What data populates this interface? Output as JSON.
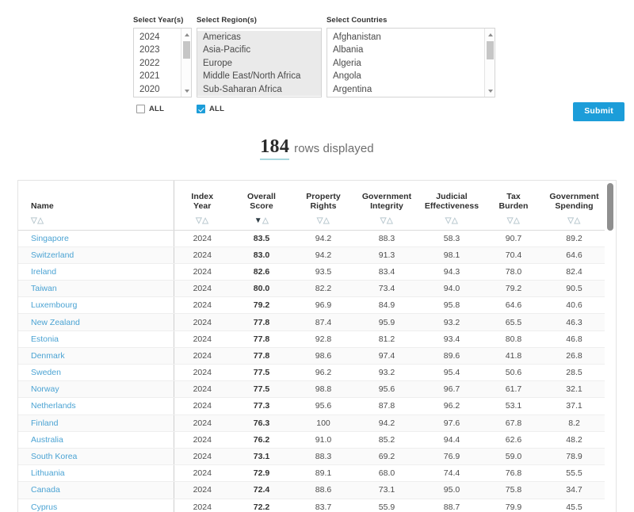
{
  "filters": {
    "year": {
      "label": "Select Year(s)",
      "options": [
        "2024",
        "2023",
        "2022",
        "2021",
        "2020"
      ],
      "selected": [],
      "all_label": "ALL",
      "all_checked": false
    },
    "region": {
      "label": "Select Region(s)",
      "options": [
        "Americas",
        "Asia-Pacific",
        "Europe",
        "Middle East/North Africa",
        "Sub-Saharan Africa"
      ],
      "selected": [
        "Americas",
        "Asia-Pacific",
        "Europe",
        "Middle East/North Africa",
        "Sub-Saharan Africa"
      ],
      "all_label": "ALL",
      "all_checked": true
    },
    "country": {
      "label": "Select Countries",
      "options": [
        "Afghanistan",
        "Albania",
        "Algeria",
        "Angola",
        "Argentina"
      ],
      "selected": []
    },
    "submit_label": "Submit"
  },
  "status": {
    "count": "184",
    "count_text": "rows displayed"
  },
  "table": {
    "columns": [
      {
        "label_line1": "Name",
        "label_line2": "",
        "sort": "none"
      },
      {
        "label_line1": "Index",
        "label_line2": "Year",
        "sort": "none"
      },
      {
        "label_line1": "Overall",
        "label_line2": "Score",
        "sort": "desc"
      },
      {
        "label_line1": "Property",
        "label_line2": "Rights",
        "sort": "none"
      },
      {
        "label_line1": "Government",
        "label_line2": "Integrity",
        "sort": "none"
      },
      {
        "label_line1": "Judicial",
        "label_line2": "Effectiveness",
        "sort": "none"
      },
      {
        "label_line1": "Tax",
        "label_line2": "Burden",
        "sort": "none"
      },
      {
        "label_line1": "Government",
        "label_line2": "Spending",
        "sort": "none"
      }
    ],
    "rows": [
      {
        "name": "Singapore",
        "year": "2024",
        "overall": "83.5",
        "property": "94.2",
        "integrity": "88.3",
        "judicial": "58.3",
        "tax": "90.7",
        "spending": "89.2"
      },
      {
        "name": "Switzerland",
        "year": "2024",
        "overall": "83.0",
        "property": "94.2",
        "integrity": "91.3",
        "judicial": "98.1",
        "tax": "70.4",
        "spending": "64.6"
      },
      {
        "name": "Ireland",
        "year": "2024",
        "overall": "82.6",
        "property": "93.5",
        "integrity": "83.4",
        "judicial": "94.3",
        "tax": "78.0",
        "spending": "82.4"
      },
      {
        "name": "Taiwan",
        "year": "2024",
        "overall": "80.0",
        "property": "82.2",
        "integrity": "73.4",
        "judicial": "94.0",
        "tax": "79.2",
        "spending": "90.5"
      },
      {
        "name": "Luxembourg",
        "year": "2024",
        "overall": "79.2",
        "property": "96.9",
        "integrity": "84.9",
        "judicial": "95.8",
        "tax": "64.6",
        "spending": "40.6"
      },
      {
        "name": "New Zealand",
        "year": "2024",
        "overall": "77.8",
        "property": "87.4",
        "integrity": "95.9",
        "judicial": "93.2",
        "tax": "65.5",
        "spending": "46.3"
      },
      {
        "name": "Estonia",
        "year": "2024",
        "overall": "77.8",
        "property": "92.8",
        "integrity": "81.2",
        "judicial": "93.4",
        "tax": "80.8",
        "spending": "46.8"
      },
      {
        "name": "Denmark",
        "year": "2024",
        "overall": "77.8",
        "property": "98.6",
        "integrity": "97.4",
        "judicial": "89.6",
        "tax": "41.8",
        "spending": "26.8"
      },
      {
        "name": "Sweden",
        "year": "2024",
        "overall": "77.5",
        "property": "96.2",
        "integrity": "93.2",
        "judicial": "95.4",
        "tax": "50.6",
        "spending": "28.5"
      },
      {
        "name": "Norway",
        "year": "2024",
        "overall": "77.5",
        "property": "98.8",
        "integrity": "95.6",
        "judicial": "96.7",
        "tax": "61.7",
        "spending": "32.1"
      },
      {
        "name": "Netherlands",
        "year": "2024",
        "overall": "77.3",
        "property": "95.6",
        "integrity": "87.8",
        "judicial": "96.2",
        "tax": "53.1",
        "spending": "37.1"
      },
      {
        "name": "Finland",
        "year": "2024",
        "overall": "76.3",
        "property": "100",
        "integrity": "94.2",
        "judicial": "97.6",
        "tax": "67.8",
        "spending": "8.2"
      },
      {
        "name": "Australia",
        "year": "2024",
        "overall": "76.2",
        "property": "91.0",
        "integrity": "85.2",
        "judicial": "94.4",
        "tax": "62.6",
        "spending": "48.2"
      },
      {
        "name": "South Korea",
        "year": "2024",
        "overall": "73.1",
        "property": "88.3",
        "integrity": "69.2",
        "judicial": "76.9",
        "tax": "59.0",
        "spending": "78.9"
      },
      {
        "name": "Lithuania",
        "year": "2024",
        "overall": "72.9",
        "property": "89.1",
        "integrity": "68.0",
        "judicial": "74.4",
        "tax": "76.8",
        "spending": "55.5"
      },
      {
        "name": "Canada",
        "year": "2024",
        "overall": "72.4",
        "property": "88.6",
        "integrity": "73.1",
        "judicial": "95.0",
        "tax": "75.8",
        "spending": "34.7"
      },
      {
        "name": "Cyprus",
        "year": "2024",
        "overall": "72.2",
        "property": "83.7",
        "integrity": "55.9",
        "judicial": "88.7",
        "tax": "79.9",
        "spending": "45.5"
      }
    ]
  },
  "colors": {
    "accent_blue": "#1c9dd9",
    "link_blue": "#4ba3d3",
    "underline_teal": "#a8d8de"
  }
}
